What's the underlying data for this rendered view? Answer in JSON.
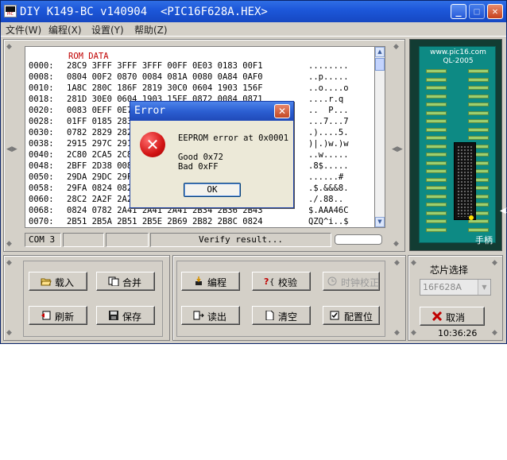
{
  "window": {
    "title": "DIY K149-BC v140904  <PIC16F628A.HEX>",
    "controls": {
      "minimize": "_",
      "maximize": "□",
      "close": "✕"
    }
  },
  "menu": [
    {
      "label": "文件(W)"
    },
    {
      "label": "编程(X)"
    },
    {
      "label": "设置(Y)"
    },
    {
      "label": "帮助(Z)"
    }
  ],
  "hex": {
    "header": "ROM DATA",
    "rows": [
      {
        "addr": "0000:",
        "data": "28C9 3FFF 3FFF 3FFF 00FF 0E03 0183 00F1",
        "ascii": "........"
      },
      {
        "addr": "0008:",
        "data": "0804 00F2 0870 0084 081A 0080 0A84 0AF0",
        "ascii": "..p....."
      },
      {
        "addr": "0010:",
        "data": "1A8C 280C 186F 2819 30C0 0604 1903 156F",
        "ascii": "..o....o"
      },
      {
        "addr": "0018:",
        "data": "281D 30E0 0604 1903 15EF 0872 0084 0871",
        "ascii": "....r.q"
      },
      {
        "addr": "0020:",
        "data": "0083 0EFF 0E7F 0009 0831 0084 0850 0950",
        "ascii": "..  P..."
      },
      {
        "addr": "0028:",
        "data": "01FF 0185 2837 0837 0185 2037 0837 0837",
        "ascii": "...7...7"
      },
      {
        "addr": "0030:",
        "data": "0782 2829 2829 2829 0E03 0183 0035 0D35",
        "ascii": ".)....5."
      },
      {
        "addr": "0038:",
        "data": "2915 297C 2915 297C 2977 3FFF 2977 3FFF",
        "ascii": ")|.)w.)w"
      },
      {
        "addr": "0040:",
        "data": "2C80 2CA5 2C80 2CA5 2977 3FFF 2977 3FFF",
        "ascii": "..w....."
      },
      {
        "addr": "0048:",
        "data": "2BFF 2D38 0083 2B03 2D38 0083 2B03 2D38",
        "ascii": ".8$....."
      },
      {
        "addr": "0050:",
        "data": "29DA 29DC 29FE 2A00 2A22 2A24 2A12 2A23",
        "ascii": "......#"
      },
      {
        "addr": "0058:",
        "data": "29FA 0824 0826 2A26 2A38 2A26 2A26 2A38",
        "ascii": ".$.&&&8."
      },
      {
        "addr": "0060:",
        "data": "28C2 2A2F 2A2F 2A2F 2A2F 2A2F 2A38 2A38",
        "ascii": "./.88.."
      },
      {
        "addr": "0068:",
        "data": "0824 0782 2A41 2A41 2A41 2B34 2B36 2B43",
        "ascii": "$.AAA46C"
      },
      {
        "addr": "0070:",
        "data": "2B51 2B5A 2B51 2B5E 2B69 2B82 2B8C 0824",
        "ascii": "QZQ^i..$"
      }
    ]
  },
  "status": {
    "port": "COM 3",
    "message": "Verify result...",
    "progress": 0
  },
  "board": {
    "brand": "www.pic16.com\nQL-2005",
    "handle": "手柄",
    "side_mark": "◀2"
  },
  "buttons": {
    "load": "载入",
    "merge": "合并",
    "refresh": "刷新",
    "save": "保存",
    "program": "编程",
    "verify": "校验",
    "clock_calibrate": "时钟校正",
    "read": "读出",
    "clear": "清空",
    "config": "配置位",
    "cancel": "取消"
  },
  "chip_select": {
    "label": "芯片选择",
    "value": "16F628A"
  },
  "clock": "10:36:26",
  "dialog": {
    "title": "Error",
    "message": "EEPROM error at 0x0001",
    "good": "Good 0x72",
    "bad": "Bad 0xFF",
    "ok": "OK"
  },
  "colors": {
    "rom_header": "#c00000",
    "title_bar": "#1c56d8",
    "board": "#0d8a84"
  }
}
